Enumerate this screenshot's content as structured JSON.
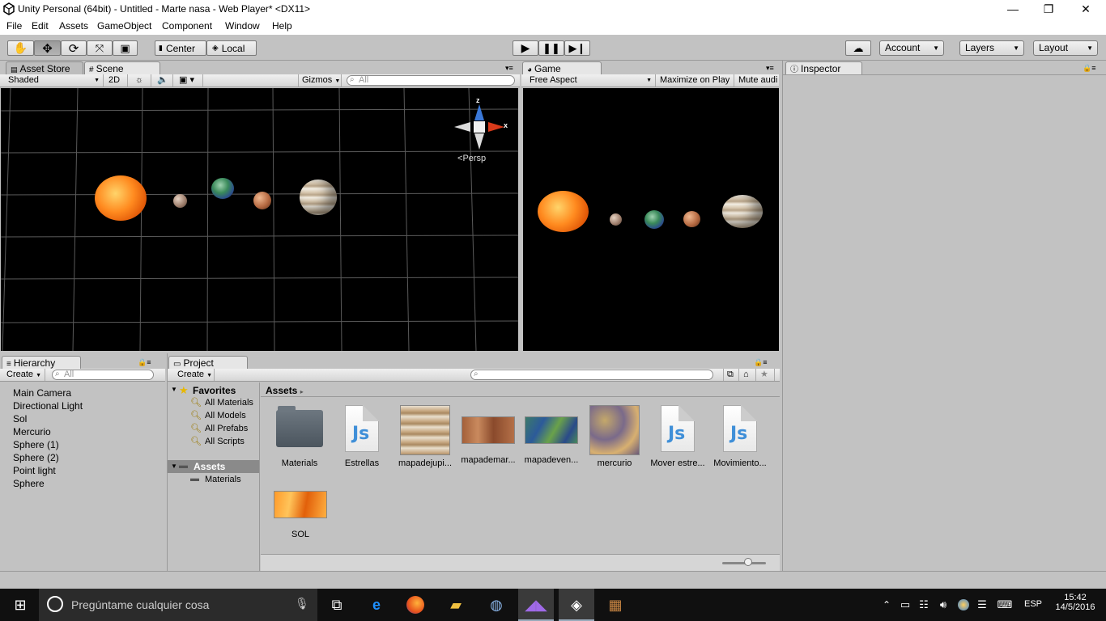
{
  "window": {
    "title": "Unity Personal (64bit) - Untitled - Marte nasa - Web Player* <DX11>",
    "minimize": "—",
    "maximize": "❐",
    "close": "✕"
  },
  "menu": [
    "File",
    "Edit",
    "Assets",
    "GameObject",
    "Component",
    "Window",
    "Help"
  ],
  "toolbar": {
    "center_label": "Center",
    "local_label": "Local",
    "account_label": "Account",
    "layers_label": "Layers",
    "layout_label": "Layout"
  },
  "scene": {
    "tab_asset_store": "Asset Store",
    "tab_scene": "Scene",
    "shaded": "Shaded",
    "mode_2d": "2D",
    "gizmos": "Gizmos",
    "search_placeholder": "All",
    "persp": "Persp",
    "axis_z": "z",
    "axis_x": "x"
  },
  "game": {
    "tab": "Game",
    "aspect": "Free Aspect",
    "maximize": "Maximize on Play",
    "mute": "Mute audi"
  },
  "inspector": {
    "tab": "Inspector"
  },
  "hierarchy": {
    "tab": "Hierarchy",
    "create": "Create",
    "search_placeholder": "All",
    "items": [
      "Main Camera",
      "Directional Light",
      "Sol",
      "Mercurio",
      "Sphere (1)",
      "Sphere (2)",
      "Point light",
      "Sphere"
    ]
  },
  "project": {
    "tab": "Project",
    "create": "Create",
    "favorites": "Favorites",
    "favorite_items": [
      "All Materials",
      "All Models",
      "All Prefabs",
      "All Scripts"
    ],
    "assets_root": "Assets",
    "assets_child": "Materials",
    "breadcrumb": "Assets",
    "assets": [
      {
        "name": "Materials",
        "kind": "folder"
      },
      {
        "name": "Estrellas",
        "kind": "script"
      },
      {
        "name": "mapadejupi...",
        "kind": "texture-jupiter"
      },
      {
        "name": "mapademar...",
        "kind": "texture-mars"
      },
      {
        "name": "mapadeven...",
        "kind": "texture-venus"
      },
      {
        "name": "mercurio",
        "kind": "texture-mercury"
      },
      {
        "name": "Mover estre...",
        "kind": "script"
      },
      {
        "name": "Movimiento...",
        "kind": "script"
      },
      {
        "name": "SOL",
        "kind": "texture-sun"
      }
    ]
  },
  "taskbar": {
    "search_placeholder": "Pregúntame cualquier cosa",
    "lang": "ESP",
    "time": "15:42",
    "date": "14/5/2016"
  }
}
